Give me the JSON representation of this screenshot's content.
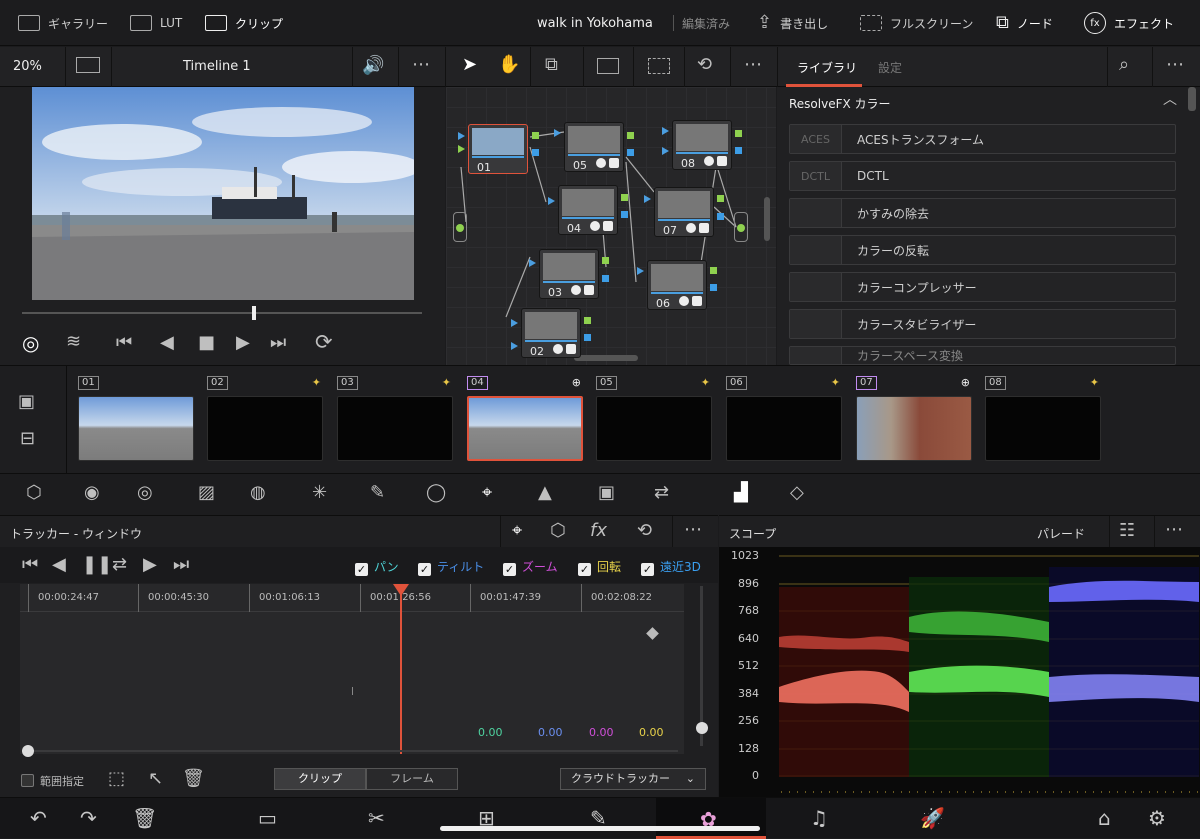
{
  "topbar": {
    "gallery": "ギャラリー",
    "lut": "LUT",
    "clip": "クリップ",
    "project_title": "walk in Yokohama",
    "project_status": "編集済み",
    "export": "書き出し",
    "fullscreen": "フルスクリーン",
    "nodes": "ノード",
    "effects": "エフェクト"
  },
  "viewer": {
    "zoom": "20%",
    "timeline_name": "Timeline 1",
    "more": "⋯"
  },
  "node_graph": {
    "nodes": [
      {
        "label": "01"
      },
      {
        "label": "05"
      },
      {
        "label": "08"
      },
      {
        "label": "04"
      },
      {
        "label": "07"
      },
      {
        "label": "03"
      },
      {
        "label": "06"
      },
      {
        "label": "02"
      }
    ]
  },
  "library": {
    "tab_library": "ライブラリ",
    "tab_settings": "設定",
    "section": "ResolveFX カラー",
    "items": [
      {
        "icon_text": "ACES",
        "label": "ACESトランスフォーム"
      },
      {
        "icon_text": "DCTL",
        "label": "DCTL"
      },
      {
        "icon_text": "",
        "label": "かすみの除去"
      },
      {
        "icon_text": "",
        "label": "カラーの反転"
      },
      {
        "icon_text": "",
        "label": "カラーコンプレッサー"
      },
      {
        "icon_text": "",
        "label": "カラースタビライザー"
      },
      {
        "icon_text": "",
        "label": "カラースペース変換"
      }
    ]
  },
  "clips": [
    {
      "num": "01",
      "type": "image"
    },
    {
      "num": "02",
      "type": "black"
    },
    {
      "num": "03",
      "type": "black"
    },
    {
      "num": "04",
      "type": "image",
      "selected": true
    },
    {
      "num": "05",
      "type": "black"
    },
    {
      "num": "06",
      "type": "black"
    },
    {
      "num": "07",
      "type": "brick"
    },
    {
      "num": "08",
      "type": "black"
    }
  ],
  "tracker": {
    "title": "トラッカー - ウィンドウ",
    "pan": "パン",
    "tilt": "ティルト",
    "zoom": "ズーム",
    "rotate": "回転",
    "perspective": "遠近3D",
    "timecodes": [
      "00:00:24:47",
      "00:00:45:30",
      "00:01:06:13",
      "00:01:26:56",
      "00:01:47:39",
      "00:02:08:22"
    ],
    "values": [
      "0.00",
      "0.00",
      "0.00",
      "0.00"
    ],
    "range_label": "範囲指定",
    "clip_tab": "クリップ",
    "frame_tab": "フレーム",
    "mode": "クラウドトラッカー"
  },
  "scope": {
    "title": "スコープ",
    "mode": "パレード",
    "axis": [
      "1023",
      "896",
      "768",
      "640",
      "512",
      "384",
      "256",
      "128",
      "0"
    ]
  },
  "colors": {
    "accent": "#e0533b",
    "pan": "#4fd3d6",
    "tilt": "#4a8fe8",
    "zoom": "#d04fd9",
    "rotate": "#e8d24a",
    "perspective": "#3a9ff0"
  }
}
